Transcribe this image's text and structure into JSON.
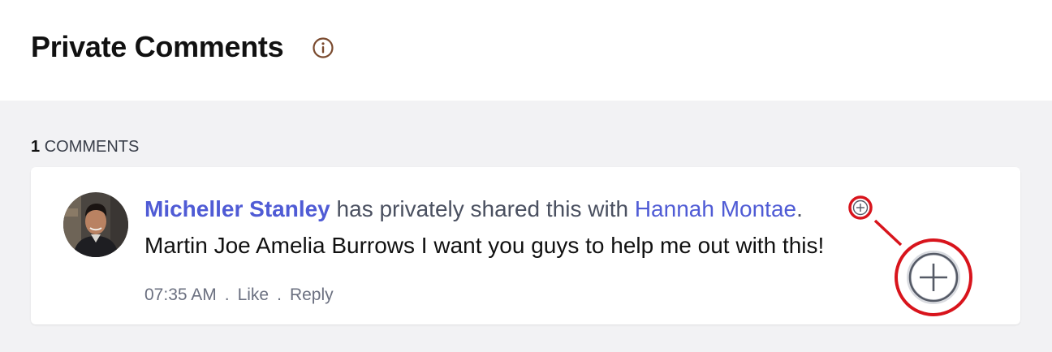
{
  "header": {
    "title": "Private Comments",
    "info_icon": "info-icon"
  },
  "comments_section": {
    "count": "1",
    "count_label": "COMMENTS"
  },
  "comment": {
    "author": "Micheller Stanley",
    "action_text": " has privately shared this with ",
    "recipient": "Hannah Montae",
    "end_punct": ".",
    "body": "Martin Joe Amelia Burrows I want you guys to help me out with this!",
    "time": "07:35 AM",
    "separator": ".",
    "like_label": "Like",
    "reply_label": "Reply",
    "avatar_icon": "user-avatar",
    "reaction_icon": "add-reaction-icon"
  },
  "colors": {
    "link": "#4f5bd5",
    "highlight": "#d8141c",
    "panel_bg": "#f2f2f4"
  }
}
